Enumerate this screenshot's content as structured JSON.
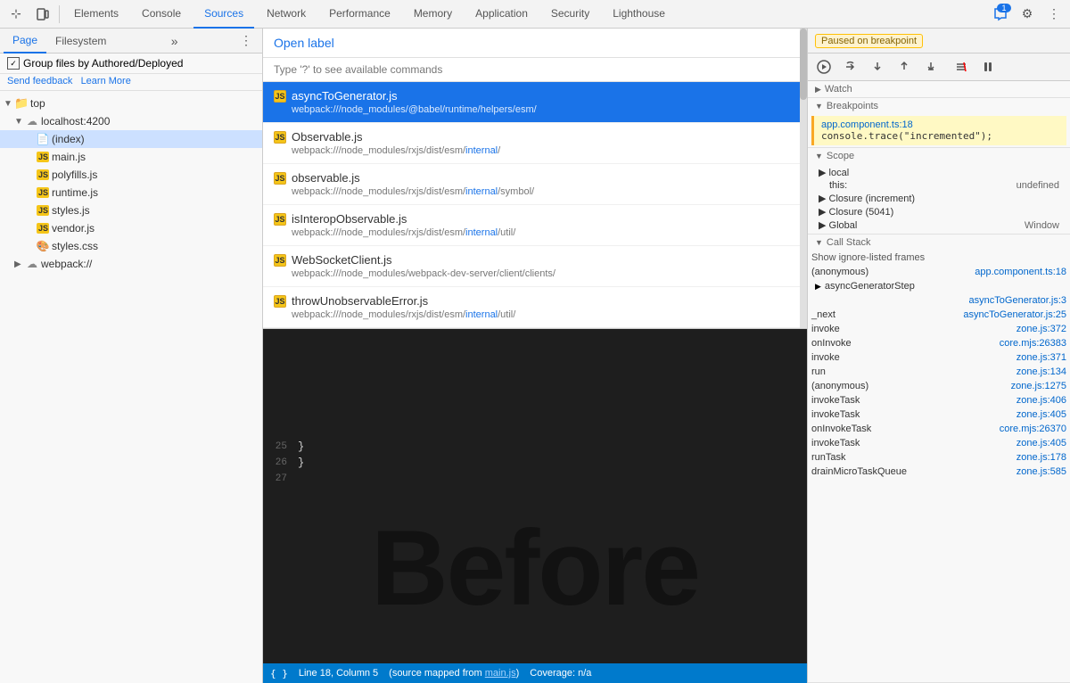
{
  "toolbar": {
    "tabs": [
      "Elements",
      "Console",
      "Sources",
      "Network",
      "Performance",
      "Memory",
      "Application",
      "Security",
      "Lighthouse"
    ],
    "active_tab": "Sources",
    "icons": {
      "cursor": "⊹",
      "device": "⬜",
      "settings": "⚙",
      "more": "⋮",
      "chat_badge": "1"
    }
  },
  "left_panel": {
    "tabs": [
      "Page",
      "Filesystem"
    ],
    "more_label": "»",
    "group_files_label": "Group files by Authored/Deployed",
    "feedback_label": "Send feedback",
    "learn_label": "Learn More",
    "tree": [
      {
        "indent": 0,
        "arrow": "▼",
        "icon": "📁",
        "label": "top",
        "type": "folder"
      },
      {
        "indent": 1,
        "arrow": "▼",
        "icon": "☁",
        "label": "localhost:4200",
        "type": "cloud"
      },
      {
        "indent": 2,
        "arrow": "",
        "icon": "📄",
        "label": "(index)",
        "type": "file",
        "selected": true
      },
      {
        "indent": 2,
        "arrow": "",
        "icon": "📜",
        "label": "main.js",
        "type": "js"
      },
      {
        "indent": 2,
        "arrow": "",
        "icon": "📜",
        "label": "polyfills.js",
        "type": "js"
      },
      {
        "indent": 2,
        "arrow": "",
        "icon": "📜",
        "label": "runtime.js",
        "type": "js"
      },
      {
        "indent": 2,
        "arrow": "",
        "icon": "📜",
        "label": "styles.js",
        "type": "js"
      },
      {
        "indent": 2,
        "arrow": "",
        "icon": "📜",
        "label": "vendor.js",
        "type": "js"
      },
      {
        "indent": 2,
        "arrow": "",
        "icon": "🎨",
        "label": "styles.css",
        "type": "css"
      },
      {
        "indent": 1,
        "arrow": "▶",
        "icon": "☁",
        "label": "webpack://",
        "type": "cloud"
      }
    ]
  },
  "open_dialog": {
    "title_open": "Open ",
    "title_label": "label",
    "hint": "Type '?' to see available commands",
    "files": [
      {
        "name": "asyncToGenerator.js",
        "path": "webpack:///node_modules/@babel/runtime/helpers/esm/",
        "path_highlight": "webpack:///node_modules/@babel/runtime/helpers/esm/",
        "selected": true
      },
      {
        "name": "Observable.js",
        "path": "webpack:///node_modules/rxjs/dist/esm/internal/",
        "path_normal": "webpack:///node_modules/rxjs/dist/esm/",
        "path_highlight": "internal",
        "path_suffix": "/",
        "selected": false
      },
      {
        "name": "observable.js",
        "path": "webpack:///node_modules/rxjs/dist/esm/internal/symbol/",
        "path_normal": "webpack:///node_modules/rxjs/dist/esm/",
        "path_highlight": "internal",
        "path_suffix": "/symbol/",
        "selected": false
      },
      {
        "name": "isInteropObservable.js",
        "path": "webpack:///node_modules/rxjs/dist/esm/internal/util/",
        "path_normal": "webpack:///node_modules/rxjs/dist/esm/",
        "path_highlight": "internal",
        "path_suffix": "/util/",
        "selected": false
      },
      {
        "name": "WebSocketClient.js",
        "path": "webpack:///node_modules/webpack-dev-server/client/clients/",
        "selected": false
      },
      {
        "name": "throwUnobservableError.js",
        "path": "webpack:///node_modules/rxjs/dist/esm/internal/util/",
        "path_normal": "webpack:///node_modules/rxjs/dist/esm/",
        "path_highlight": "internal",
        "path_suffix": "/util/",
        "selected": false
      }
    ]
  },
  "code": {
    "lines": [
      {
        "num": "25",
        "content": "  }"
      },
      {
        "num": "26",
        "content": "}"
      },
      {
        "num": "27",
        "content": ""
      }
    ],
    "before_text": "Before"
  },
  "status_bar": {
    "line_col": "Line 18, Column 5",
    "source_mapped": "(source mapped from main.js)",
    "coverage": "Coverage: n/a",
    "format_icon": "{ }",
    "main_link": "main.js"
  },
  "right_panel": {
    "paused_label": "Paused on breakpoint",
    "debug_icons": [
      "↺",
      "↷",
      "↓",
      "↑",
      "↪",
      "✕",
      "⏸"
    ],
    "watch_label": "Watch",
    "breakpoints_label": "Breakpoints",
    "breakpoint": {
      "file": "app.component.ts:18",
      "code": "console.trace(\"incremented\");"
    },
    "scope_label": "Scope",
    "scope_items": [
      {
        "label": "local",
        "value": ""
      },
      {
        "label": "this:",
        "value": "undefined"
      },
      {
        "label": "Closure (increment)",
        "value": ""
      },
      {
        "label": "Closure (5041)",
        "value": ""
      },
      {
        "label": "Global",
        "value": "Window"
      }
    ],
    "call_stack_label": "Call Stack",
    "show_ignore_label": "Show ignore-listed frames",
    "call_stack": [
      {
        "func": "(anonymous)",
        "loc": "app.component.ts:18"
      },
      {
        "func": "▶ asyncGeneratorStep",
        "loc": ""
      },
      {
        "func": "",
        "loc": "asyncToGenerator.js:3"
      },
      {
        "func": "_next",
        "loc": "asyncToGenerator.js:25"
      },
      {
        "func": "invoke",
        "loc": "zone.js:372"
      },
      {
        "func": "onInvoke",
        "loc": "core.mjs:26383"
      },
      {
        "func": "invoke",
        "loc": "zone.js:371"
      },
      {
        "func": "run",
        "loc": "zone.js:134"
      },
      {
        "func": "(anonymous)",
        "loc": "zone.js:1275"
      },
      {
        "func": "invokeTask",
        "loc": "zone.js:406"
      },
      {
        "func": "invokeTask",
        "loc": "zone.js:405"
      },
      {
        "func": "onInvokeTask",
        "loc": "core.mjs:26370"
      },
      {
        "func": "invokeTask",
        "loc": "zone.js:405"
      },
      {
        "func": "runTask",
        "loc": "zone.js:178"
      },
      {
        "func": "drainMicroTaskQueue",
        "loc": "zone.js:585"
      }
    ]
  }
}
